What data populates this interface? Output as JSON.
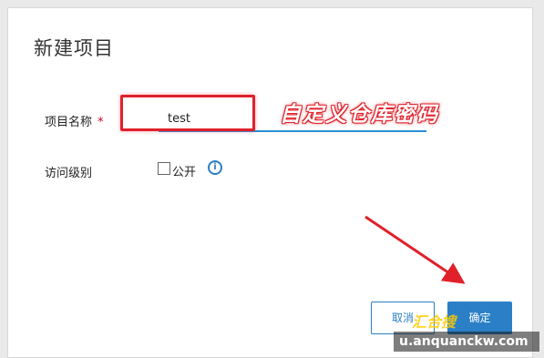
{
  "dialog": {
    "title": "新建项目",
    "project_name_label": "项目名称",
    "required_mark": "*",
    "project_name_value": "test",
    "access_level_label": "访问级别",
    "public_label": "公开",
    "public_checked": false,
    "info_icon": "info-icon",
    "info_glyph": "i",
    "cancel_label": "取消",
    "ok_label": "确定"
  },
  "annotation": {
    "text": "自定义仓库密码",
    "color": "#e0212a"
  },
  "watermark": {
    "brand_text": "汇合搜",
    "site_text": "u.anquanckw.com"
  },
  "colors": {
    "accent": "#2a7fc6",
    "annotation_red": "#e0212a"
  }
}
